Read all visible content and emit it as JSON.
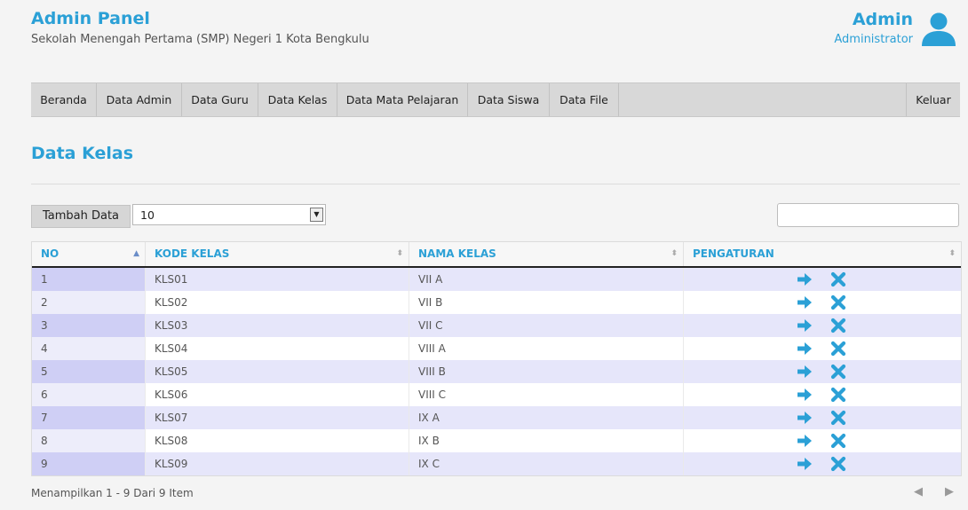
{
  "header": {
    "title": "Admin Panel",
    "subtitle": "Sekolah Menengah Pertama (SMP) Negeri 1 Kota Bengkulu",
    "user_name": "Admin",
    "user_role": "Administrator",
    "avatar_icon": "user-icon",
    "accent_color": "#2ba0d6"
  },
  "nav": {
    "items": [
      "Beranda",
      "Data Admin",
      "Data Guru",
      "Data Kelas",
      "Data Mata Pelajaran",
      "Data Siswa",
      "Data File"
    ],
    "logout": "Keluar"
  },
  "main": {
    "title": "Data Kelas",
    "add_button": "Tambah Data",
    "page_size": "10",
    "search_value": ""
  },
  "table": {
    "columns": [
      "NO",
      "KODE KELAS",
      "NAMA KELAS",
      "PENGATURAN"
    ],
    "rows": [
      {
        "no": "1",
        "kode": "KLS01",
        "nama": "VII A"
      },
      {
        "no": "2",
        "kode": "KLS02",
        "nama": "VII B"
      },
      {
        "no": "3",
        "kode": "KLS03",
        "nama": "VII C"
      },
      {
        "no": "4",
        "kode": "KLS04",
        "nama": "VIII A"
      },
      {
        "no": "5",
        "kode": "KLS05",
        "nama": "VIII B"
      },
      {
        "no": "6",
        "kode": "KLS06",
        "nama": "VIII C"
      },
      {
        "no": "7",
        "kode": "KLS07",
        "nama": "IX A"
      },
      {
        "no": "8",
        "kode": "KLS08",
        "nama": "IX B"
      },
      {
        "no": "9",
        "kode": "KLS09",
        "nama": "IX C"
      }
    ],
    "actions": [
      "arrow-right-icon",
      "close-icon"
    ]
  },
  "footer": {
    "info": "Menampilkan 1 - 9 Dari 9 Item",
    "prev_icon": "prev-icon",
    "next_icon": "next-icon"
  }
}
